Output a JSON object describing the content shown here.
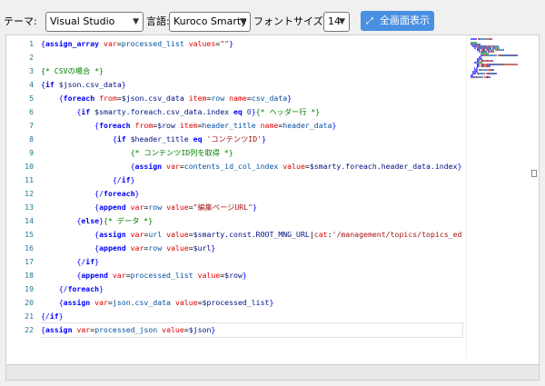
{
  "toolbar": {
    "theme_label": "テーマ:",
    "theme_value": "Visual Studio",
    "lang_label": "言語:",
    "lang_value": "Kuroco Smarty",
    "font_label": "フォントサイズ:",
    "font_value": "14",
    "fullscreen_label": "全画面表示"
  },
  "editor": {
    "lines": [
      [
        [
          "t-punc",
          "{"
        ],
        [
          "t-kw",
          "assign_array"
        ],
        [
          "t-txt",
          " "
        ],
        [
          "t-attr",
          "var"
        ],
        [
          "t-eq",
          "="
        ],
        [
          "t-val",
          "processed_list"
        ],
        [
          "t-txt",
          " "
        ],
        [
          "t-attr",
          "values"
        ],
        [
          "t-eq",
          "="
        ],
        [
          "t-str",
          "\"\""
        ],
        [
          "t-punc",
          "}"
        ]
      ],
      [],
      [
        [
          "t-com",
          "{* CSVの場合 *}"
        ]
      ],
      [
        [
          "t-punc",
          "{"
        ],
        [
          "t-kw",
          "if"
        ],
        [
          "t-txt",
          " "
        ],
        [
          "t-var",
          "$json.csv_data"
        ],
        [
          "t-punc",
          "}"
        ]
      ],
      [
        [
          "t-txt",
          "    "
        ],
        [
          "t-punc",
          "{"
        ],
        [
          "t-kw",
          "foreach"
        ],
        [
          "t-txt",
          " "
        ],
        [
          "t-attr",
          "from"
        ],
        [
          "t-eq",
          "="
        ],
        [
          "t-var",
          "$json.csv_data"
        ],
        [
          "t-txt",
          " "
        ],
        [
          "t-attr",
          "item"
        ],
        [
          "t-eq",
          "="
        ],
        [
          "t-val",
          "row"
        ],
        [
          "t-txt",
          " "
        ],
        [
          "t-attr",
          "name"
        ],
        [
          "t-eq",
          "="
        ],
        [
          "t-val",
          "csv_data"
        ],
        [
          "t-punc",
          "}"
        ]
      ],
      [
        [
          "t-txt",
          "        "
        ],
        [
          "t-punc",
          "{"
        ],
        [
          "t-kw",
          "if"
        ],
        [
          "t-txt",
          " "
        ],
        [
          "t-var",
          "$smarty.foreach.csv_data.index"
        ],
        [
          "t-txt",
          " "
        ],
        [
          "t-kw",
          "eq"
        ],
        [
          "t-txt",
          " "
        ],
        [
          "t-val",
          "0"
        ],
        [
          "t-punc",
          "}"
        ],
        [
          "t-com",
          "{* ヘッダー行 *}"
        ]
      ],
      [
        [
          "t-txt",
          "            "
        ],
        [
          "t-punc",
          "{"
        ],
        [
          "t-kw",
          "foreach"
        ],
        [
          "t-txt",
          " "
        ],
        [
          "t-attr",
          "from"
        ],
        [
          "t-eq",
          "="
        ],
        [
          "t-var",
          "$row"
        ],
        [
          "t-txt",
          " "
        ],
        [
          "t-attr",
          "item"
        ],
        [
          "t-eq",
          "="
        ],
        [
          "t-val",
          "header_title"
        ],
        [
          "t-txt",
          " "
        ],
        [
          "t-attr",
          "name"
        ],
        [
          "t-eq",
          "="
        ],
        [
          "t-val",
          "header_data"
        ],
        [
          "t-punc",
          "}"
        ]
      ],
      [
        [
          "t-txt",
          "                "
        ],
        [
          "t-punc",
          "{"
        ],
        [
          "t-kw",
          "if"
        ],
        [
          "t-txt",
          " "
        ],
        [
          "t-var",
          "$header_title"
        ],
        [
          "t-txt",
          " "
        ],
        [
          "t-kw",
          "eq"
        ],
        [
          "t-txt",
          " "
        ],
        [
          "t-str",
          "'コンテンツID'"
        ],
        [
          "t-punc",
          "}"
        ]
      ],
      [
        [
          "t-txt",
          "                    "
        ],
        [
          "t-com",
          "{* コンテンツID列を取得 *}"
        ]
      ],
      [
        [
          "t-txt",
          "                    "
        ],
        [
          "t-punc",
          "{"
        ],
        [
          "t-kw",
          "assign"
        ],
        [
          "t-txt",
          " "
        ],
        [
          "t-attr",
          "var"
        ],
        [
          "t-eq",
          "="
        ],
        [
          "t-val",
          "contents_id_col_index"
        ],
        [
          "t-txt",
          " "
        ],
        [
          "t-attr",
          "value"
        ],
        [
          "t-eq",
          "="
        ],
        [
          "t-var",
          "$smarty.foreach.header_data.index"
        ],
        [
          "t-punc",
          "}"
        ]
      ],
      [
        [
          "t-txt",
          "                "
        ],
        [
          "t-punc",
          "{/"
        ],
        [
          "t-kw",
          "if"
        ],
        [
          "t-punc",
          "}"
        ]
      ],
      [
        [
          "t-txt",
          "            "
        ],
        [
          "t-punc",
          "{/"
        ],
        [
          "t-kw",
          "foreach"
        ],
        [
          "t-punc",
          "}"
        ]
      ],
      [
        [
          "t-txt",
          "            "
        ],
        [
          "t-punc",
          "{"
        ],
        [
          "t-kw",
          "append"
        ],
        [
          "t-txt",
          " "
        ],
        [
          "t-attr",
          "var"
        ],
        [
          "t-eq",
          "="
        ],
        [
          "t-val",
          "row"
        ],
        [
          "t-txt",
          " "
        ],
        [
          "t-attr",
          "value"
        ],
        [
          "t-eq",
          "="
        ],
        [
          "t-str",
          "\"編集ページURL\""
        ],
        [
          "t-punc",
          "}"
        ]
      ],
      [
        [
          "t-txt",
          "        "
        ],
        [
          "t-punc",
          "{"
        ],
        [
          "t-kw",
          "else"
        ],
        [
          "t-punc",
          "}"
        ],
        [
          "t-com",
          "{* データ *}"
        ]
      ],
      [
        [
          "t-txt",
          "            "
        ],
        [
          "t-punc",
          "{"
        ],
        [
          "t-kw",
          "assign"
        ],
        [
          "t-txt",
          " "
        ],
        [
          "t-attr",
          "var"
        ],
        [
          "t-eq",
          "="
        ],
        [
          "t-val",
          "url"
        ],
        [
          "t-txt",
          " "
        ],
        [
          "t-attr",
          "value"
        ],
        [
          "t-eq",
          "="
        ],
        [
          "t-var",
          "$smarty.const.ROOT_MNG_URL"
        ],
        [
          "t-txt",
          "|"
        ],
        [
          "t-attr",
          "cat"
        ],
        [
          "t-txt",
          ":"
        ],
        [
          "t-str",
          "'/management/topics/topics_ed"
        ]
      ],
      [
        [
          "t-txt",
          "            "
        ],
        [
          "t-punc",
          "{"
        ],
        [
          "t-kw",
          "append"
        ],
        [
          "t-txt",
          " "
        ],
        [
          "t-attr",
          "var"
        ],
        [
          "t-eq",
          "="
        ],
        [
          "t-val",
          "row"
        ],
        [
          "t-txt",
          " "
        ],
        [
          "t-attr",
          "value"
        ],
        [
          "t-eq",
          "="
        ],
        [
          "t-var",
          "$url"
        ],
        [
          "t-punc",
          "}"
        ]
      ],
      [
        [
          "t-txt",
          "        "
        ],
        [
          "t-punc",
          "{/"
        ],
        [
          "t-kw",
          "if"
        ],
        [
          "t-punc",
          "}"
        ]
      ],
      [
        [
          "t-txt",
          "        "
        ],
        [
          "t-punc",
          "{"
        ],
        [
          "t-kw",
          "append"
        ],
        [
          "t-txt",
          " "
        ],
        [
          "t-attr",
          "var"
        ],
        [
          "t-eq",
          "="
        ],
        [
          "t-val",
          "processed_list"
        ],
        [
          "t-txt",
          " "
        ],
        [
          "t-attr",
          "value"
        ],
        [
          "t-eq",
          "="
        ],
        [
          "t-var",
          "$row"
        ],
        [
          "t-punc",
          "}"
        ]
      ],
      [
        [
          "t-txt",
          "    "
        ],
        [
          "t-punc",
          "{/"
        ],
        [
          "t-kw",
          "foreach"
        ],
        [
          "t-punc",
          "}"
        ]
      ],
      [
        [
          "t-txt",
          "    "
        ],
        [
          "t-punc",
          "{"
        ],
        [
          "t-kw",
          "assign"
        ],
        [
          "t-txt",
          " "
        ],
        [
          "t-attr",
          "var"
        ],
        [
          "t-eq",
          "="
        ],
        [
          "t-val",
          "json.csv_data"
        ],
        [
          "t-txt",
          " "
        ],
        [
          "t-attr",
          "value"
        ],
        [
          "t-eq",
          "="
        ],
        [
          "t-var",
          "$processed_list"
        ],
        [
          "t-punc",
          "}"
        ]
      ],
      [
        [
          "t-punc",
          "{/"
        ],
        [
          "t-kw",
          "if"
        ],
        [
          "t-punc",
          "}"
        ]
      ],
      [
        [
          "t-punc",
          "{"
        ],
        [
          "t-kw",
          "assign"
        ],
        [
          "t-txt",
          " "
        ],
        [
          "t-attr",
          "var"
        ],
        [
          "t-eq",
          "="
        ],
        [
          "t-val",
          "processed_json"
        ],
        [
          "t-txt",
          " "
        ],
        [
          "t-attr",
          "value"
        ],
        [
          "t-eq",
          "="
        ],
        [
          "t-var",
          "$json"
        ],
        [
          "t-punc",
          "}"
        ]
      ]
    ],
    "current_line": 22
  },
  "colors": {
    "button_bg": "#4a90e2",
    "line_number": "#237893",
    "keyword": "#0000ff",
    "attribute": "#e50000",
    "string": "#a31515",
    "comment": "#008000"
  }
}
